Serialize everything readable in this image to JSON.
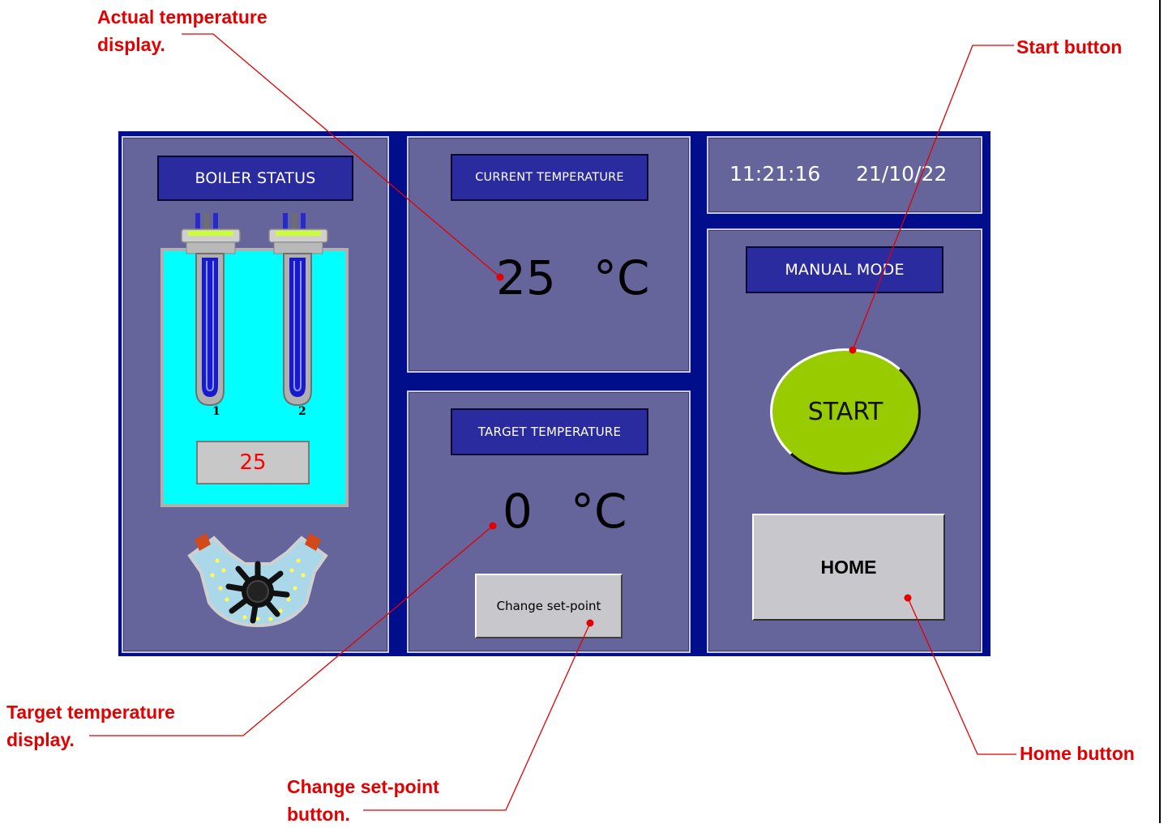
{
  "boiler": {
    "title": "BOILER STATUS",
    "heater_labels": [
      "1",
      "2"
    ],
    "water_temp": "25"
  },
  "current": {
    "title": "CURRENT TEMPERATURE",
    "value": "25",
    "unit": "°C"
  },
  "target": {
    "title": "TARGET TEMPERATURE",
    "value": "0",
    "unit": "°C",
    "change_button": "Change set-point"
  },
  "clock": {
    "time": "11:21:16",
    "date": "21/10/22"
  },
  "mode": {
    "title": "MANUAL MODE",
    "start_button": "START",
    "home_button": "HOME"
  },
  "annotations": {
    "actual_temp": [
      "Actual temperature",
      "display."
    ],
    "start": "Start button",
    "target_temp": [
      "Target temperature",
      "display."
    ],
    "change_setpoint": [
      "Change set-point",
      "button."
    ],
    "home": "Home button"
  },
  "colors": {
    "panel_bg": "#65659b",
    "frame_bg": "#000e8c",
    "label_bg": "#2b2ba0",
    "start_green": "#99cc00",
    "water": "#00ffff",
    "annotation_red": "#e30000",
    "water_temp_text": "#ff0000"
  }
}
